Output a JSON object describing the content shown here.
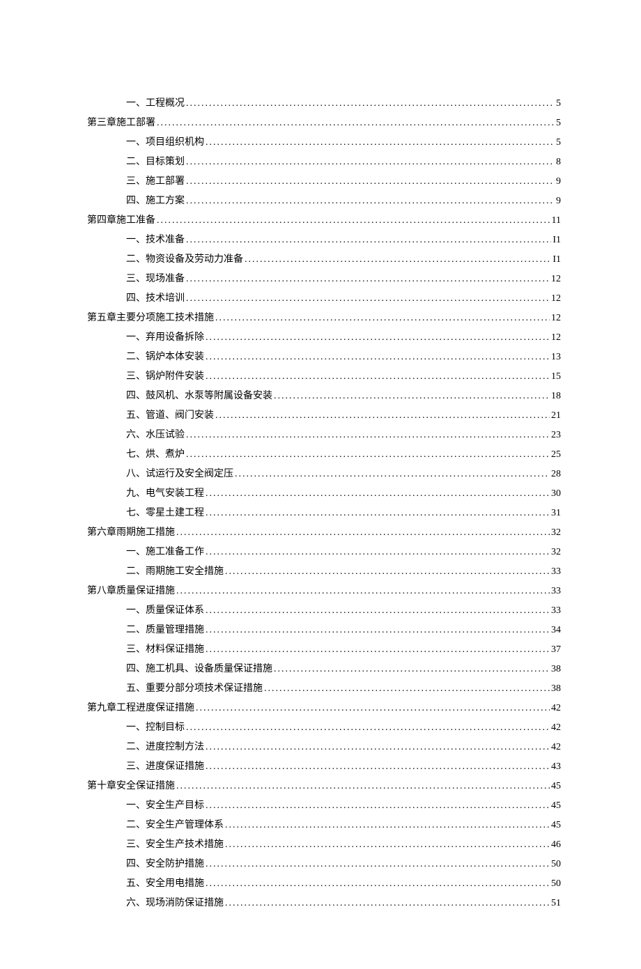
{
  "toc": [
    {
      "level": 2,
      "label": "一、工程概况",
      "page": "5"
    },
    {
      "level": 1,
      "label": "第三章施工部署",
      "page": "5"
    },
    {
      "level": 2,
      "label": "一、项目组织机构",
      "page": "5"
    },
    {
      "level": 2,
      "label": "二、目标策划",
      "page": "8"
    },
    {
      "level": 2,
      "label": "三、施工部署",
      "page": "9"
    },
    {
      "level": 2,
      "label": "四、施工方案",
      "page": "9"
    },
    {
      "level": 1,
      "label": "第四章施工准备",
      "page": "11"
    },
    {
      "level": 2,
      "label": "一、技术准备",
      "page": "I1"
    },
    {
      "level": 2,
      "label": "二、物资设备及劳动力准备",
      "page": "I1"
    },
    {
      "level": 2,
      "label": "三、现场准备",
      "page": "12"
    },
    {
      "level": 2,
      "label": "四、技术培训",
      "page": "12"
    },
    {
      "level": 1,
      "label": "第五章主要分项施工技术措施",
      "page": "12"
    },
    {
      "level": 2,
      "label": "一、弃用设备拆除",
      "page": "12"
    },
    {
      "level": 2,
      "label": "二、锅炉本体安装",
      "page": "13"
    },
    {
      "level": 2,
      "label": "三、锅炉附件安装",
      "page": "15"
    },
    {
      "level": 2,
      "label": "四、鼓风机、水泵等附属设备安装",
      "page": "18"
    },
    {
      "level": 2,
      "label": "五、管道、阀门安装",
      "page": "21"
    },
    {
      "level": 2,
      "label": "六、水压试验",
      "page": "23"
    },
    {
      "level": 2,
      "label": "七、烘、煮炉",
      "page": "25"
    },
    {
      "level": 2,
      "label": "八、试运行及安全阀定压",
      "page": "28"
    },
    {
      "level": 2,
      "label": "九、电气安装工程",
      "page": "30"
    },
    {
      "level": 2,
      "label": "七、零星土建工程",
      "page": "31"
    },
    {
      "level": 1,
      "label": "第六章雨期施工措施",
      "page": "32"
    },
    {
      "level": 2,
      "label": "一、施工准备工作",
      "page": "32"
    },
    {
      "level": 2,
      "label": "二、雨期施工安全措施",
      "page": "33"
    },
    {
      "level": 1,
      "label": "第八章质量保证措施",
      "page": "33"
    },
    {
      "level": 2,
      "label": "一、质量保证体系",
      "page": "33"
    },
    {
      "level": 2,
      "label": "二、质量管理措施",
      "page": "34"
    },
    {
      "level": 2,
      "label": "三、材料保证措施",
      "page": "37"
    },
    {
      "level": 2,
      "label": "四、施工机具、设备质量保证措施",
      "page": "38"
    },
    {
      "level": 2,
      "label": "五、重要分部分项技术保证措施",
      "page": "38"
    },
    {
      "level": 1,
      "label": "第九章工程进度保证措施",
      "page": "42"
    },
    {
      "level": 2,
      "label": "一、控制目标",
      "page": "42"
    },
    {
      "level": 2,
      "label": "二、进度控制方法",
      "page": "42"
    },
    {
      "level": 2,
      "label": "三、进度保证措施",
      "page": "43"
    },
    {
      "level": 1,
      "label": "第十章安全保证措施",
      "page": "45"
    },
    {
      "level": 2,
      "label": "一、安全生产目标",
      "page": "45"
    },
    {
      "level": 2,
      "label": "二、安全生产管理体系",
      "page": "45"
    },
    {
      "level": 2,
      "label": "三、安全生产技术措施",
      "page": "46"
    },
    {
      "level": 2,
      "label": "四、安全防护措施",
      "page": "50"
    },
    {
      "level": 2,
      "label": "五、安全用电措施",
      "page": "50"
    },
    {
      "level": 2,
      "label": "六、现场消防保证措施",
      "page": "51"
    }
  ]
}
